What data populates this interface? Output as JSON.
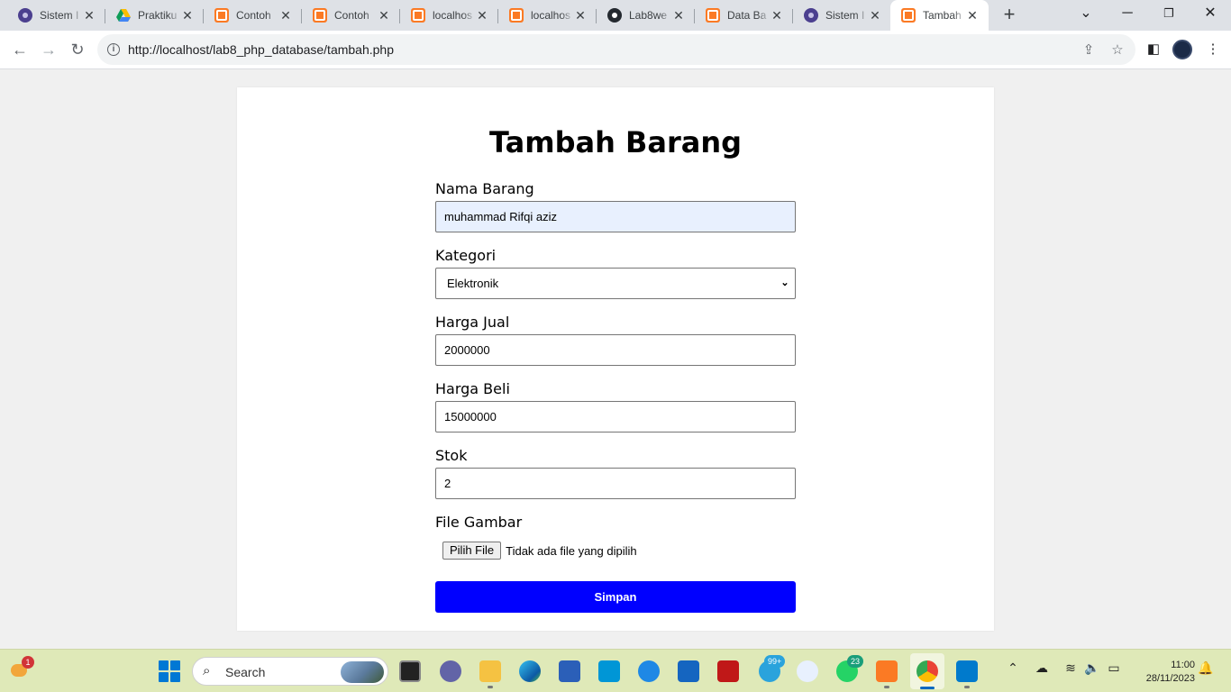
{
  "browser": {
    "tabs": [
      {
        "title": "Sistem I",
        "icon": "sistem-favicon"
      },
      {
        "title": "Praktiku",
        "icon": "google-drive-favicon"
      },
      {
        "title": "Contoh",
        "icon": "xampp-favicon"
      },
      {
        "title": "Contoh",
        "icon": "xampp-favicon"
      },
      {
        "title": "localhos",
        "icon": "xampp-favicon"
      },
      {
        "title": "localhos",
        "icon": "xampp-favicon"
      },
      {
        "title": "Lab8we",
        "icon": "github-favicon"
      },
      {
        "title": "Data Ba",
        "icon": "xampp-favicon"
      },
      {
        "title": "Sistem I",
        "icon": "sistem-favicon"
      },
      {
        "title": "Tambah",
        "icon": "xampp-favicon",
        "active": true
      }
    ],
    "address": "http://localhost/lab8_php_database/tambah.php"
  },
  "form": {
    "title": "Tambah Barang",
    "nama_label": "Nama Barang",
    "nama_value": "muhammad Rifqi aziz",
    "kategori_label": "Kategori",
    "kategori_value": "Elektronik",
    "harga_jual_label": "Harga Jual",
    "harga_jual_value": "2000000",
    "harga_beli_label": "Harga Beli",
    "harga_beli_value": "15000000",
    "stok_label": "Stok",
    "stok_value": "2",
    "file_label": "File Gambar",
    "file_button": "Pilih File",
    "file_status": "Tidak ada file yang dipilih",
    "submit_label": "Simpan"
  },
  "taskbar": {
    "search_placeholder": "Search",
    "weather_badge": "1",
    "telegram_badge": "99+",
    "whatsapp_badge": "23",
    "time": "11:00",
    "date": "28/11/2023"
  },
  "colors": {
    "submit_button": "#0000ff",
    "autofill_field": "#e8f0fe",
    "taskbar": "#dfe9b8",
    "tabstrip": "#dee1e6"
  }
}
